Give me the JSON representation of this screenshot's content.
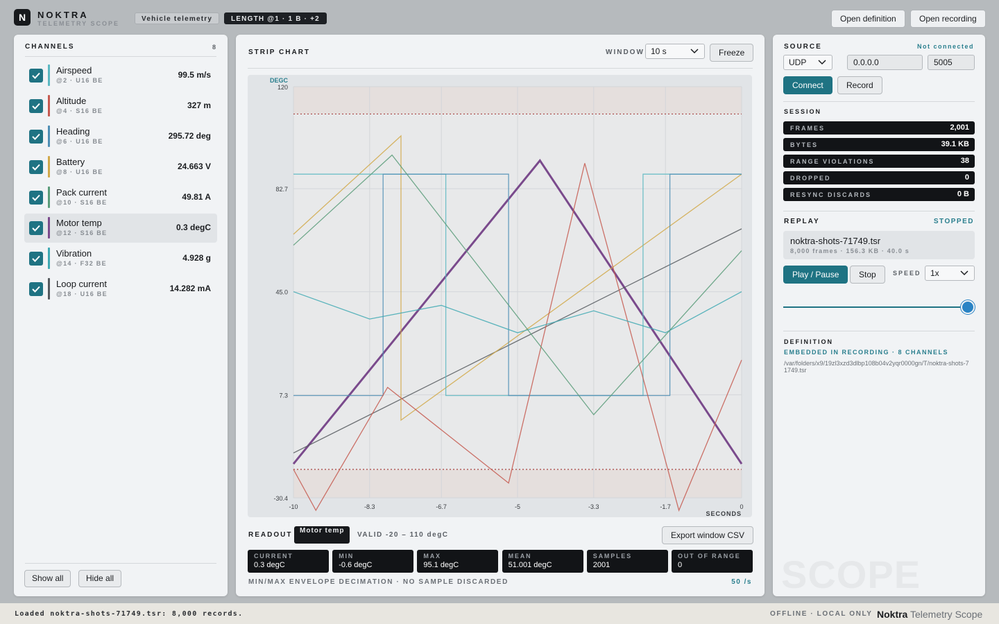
{
  "app": {
    "logo_letter": "N",
    "brand": "NOKTRA",
    "brand_sub": "TELEMETRY SCOPE",
    "pill_profile": "Vehicle telemetry",
    "pill_selection": "LENGTH @1 · 1 B · +2",
    "btn_open_definition": "Open definition",
    "btn_open_recording": "Open recording"
  },
  "channels": {
    "title": "CHANNELS",
    "count": "8",
    "items": [
      {
        "name": "Airspeed",
        "meta": "@2 · U16 BE",
        "value": "99.5 m/s",
        "color": "#5bb8c2",
        "checked": true
      },
      {
        "name": "Altitude",
        "meta": "@4 · S16 BE",
        "value": "327 m",
        "color": "#c65a50",
        "checked": true
      },
      {
        "name": "Heading",
        "meta": "@6 · U16 BE",
        "value": "295.72 deg",
        "color": "#4f8fb5",
        "checked": true
      },
      {
        "name": "Battery",
        "meta": "@8 · U16 BE",
        "value": "24.663 V",
        "color": "#d1a94a",
        "checked": true
      },
      {
        "name": "Pack current",
        "meta": "@10 · S16 BE",
        "value": "49.81 A",
        "color": "#5a9c7a",
        "checked": true
      },
      {
        "name": "Motor temp",
        "meta": "@12 · S16 BE",
        "value": "0.3 degC",
        "color": "#7a4a8c",
        "checked": true
      },
      {
        "name": "Vibration",
        "meta": "@14 · F32 BE",
        "value": "4.928 g",
        "color": "#3fa9b3",
        "checked": true
      },
      {
        "name": "Loop current",
        "meta": "@18 · U16 BE",
        "value": "14.282 mA",
        "color": "#55595e",
        "checked": true
      }
    ],
    "show_all": "Show all",
    "hide_all": "Hide all"
  },
  "strip": {
    "title": "STRIP CHART",
    "window_label": "WINDOW",
    "window_value": "10 s",
    "freeze": "Freeze"
  },
  "chart_data": {
    "type": "line",
    "ylabel": "DEGC",
    "xlabel": "SECONDS",
    "ylim": [
      -30.4,
      120
    ],
    "xlim": [
      -10,
      0
    ],
    "yticks": [
      "120",
      "82.7",
      "45.0",
      "7.3",
      "-30.4"
    ],
    "xticks": [
      "-10",
      "-8.3",
      "-6.7",
      "-5",
      "-3.3",
      "-1.7",
      "0"
    ],
    "valid_range": [
      -20,
      110
    ],
    "grid": true,
    "series": [
      {
        "name": "Motor temp",
        "color": "#7a4a8c",
        "highlight": true,
        "x": [
          -10,
          -4.5,
          0
        ],
        "y": [
          -18,
          93,
          -18
        ]
      },
      {
        "name": "Loop current",
        "color": "#55595e",
        "x": [
          -10,
          0
        ],
        "y": [
          -14,
          68
        ]
      },
      {
        "name": "Battery",
        "color": "#d1a94a",
        "x": [
          -10,
          -7.6,
          -7.6,
          0
        ],
        "y": [
          66,
          102,
          -2,
          88
        ]
      },
      {
        "name": "Airspeed",
        "color": "#5bb8c2",
        "x": [
          -10,
          -6.6,
          -6.6,
          -2.2,
          -2.2,
          0
        ],
        "y": [
          88,
          88,
          7,
          7,
          88,
          88
        ]
      },
      {
        "name": "Heading",
        "color": "#4f8fb5",
        "x": [
          -10,
          -8.0,
          -8.0,
          -5.2,
          -5.2,
          -1.6,
          -1.6,
          0
        ],
        "y": [
          7,
          7,
          88,
          88,
          7,
          7,
          88,
          88
        ]
      },
      {
        "name": "Altitude",
        "color": "#c65a50",
        "x": [
          -10,
          -9.5,
          -7.9,
          -5.2,
          -3.5,
          -1.4,
          0
        ],
        "y": [
          -20,
          -35,
          10,
          -25,
          92,
          -35,
          20
        ]
      },
      {
        "name": "Vibration",
        "color": "#3fa9b3",
        "x": [
          -10,
          -8.3,
          -6.7,
          -5,
          -3.3,
          -1.7,
          0
        ],
        "y": [
          45,
          35,
          40,
          30,
          38,
          30,
          45
        ]
      },
      {
        "name": "Pack current",
        "color": "#5a9c7a",
        "x": [
          -10,
          -7.8,
          -3.3,
          0
        ],
        "y": [
          62,
          95,
          0,
          60
        ]
      }
    ]
  },
  "readout": {
    "label": "READOUT",
    "channel": "Motor temp",
    "valid": "VALID -20 – 110 degC",
    "export": "Export window CSV",
    "stats": [
      {
        "key": "CURRENT",
        "value": "0.3 degC"
      },
      {
        "key": "MIN",
        "value": "-0.6 degC"
      },
      {
        "key": "MAX",
        "value": "95.1 degC"
      },
      {
        "key": "MEAN",
        "value": "51.001 degC"
      },
      {
        "key": "SAMPLES",
        "value": "2001"
      },
      {
        "key": "OUT OF RANGE",
        "value": "0"
      }
    ],
    "footnote": "MIN/MAX ENVELOPE DECIMATION · NO SAMPLE DISCARDED",
    "rate": "50 /s"
  },
  "source": {
    "title": "SOURCE",
    "status": "Not connected",
    "protocol": "UDP",
    "host": "0.0.0.0",
    "port": "5005",
    "connect": "Connect",
    "record": "Record"
  },
  "session": {
    "title": "SESSION",
    "metrics": [
      {
        "key": "FRAMES",
        "value": "2,001"
      },
      {
        "key": "BYTES",
        "value": "39.1 KB"
      },
      {
        "key": "RANGE VIOLATIONS",
        "value": "38"
      },
      {
        "key": "DROPPED",
        "value": "0"
      },
      {
        "key": "RESYNC DISCARDS",
        "value": "0 B"
      }
    ]
  },
  "replay": {
    "title": "REPLAY",
    "status": "STOPPED",
    "file": "noktra-shots-71749.tsr",
    "file_meta": "8,000 frames · 156.3 KB · 40.0 s",
    "play": "Play / Pause",
    "stop": "Stop",
    "speed_label": "SPEED",
    "speed": "1x",
    "position": 1.0
  },
  "definition": {
    "title": "DEFINITION",
    "source": "EMBEDDED IN RECORDING · 8 CHANNELS",
    "path": "/var/folders/x9/19zl3xzd3dlbp108b04v2yqr0000gn/T/noktra-shots-71749.tsr"
  },
  "watermark": "SCOPE",
  "statusbar": {
    "left": "Loaded noktra-shots-71749.tsr: 8,000 records.",
    "mode": "OFFLINE · LOCAL ONLY",
    "brand_bold": "Noktra",
    "brand_rest": "Telemetry Scope"
  }
}
